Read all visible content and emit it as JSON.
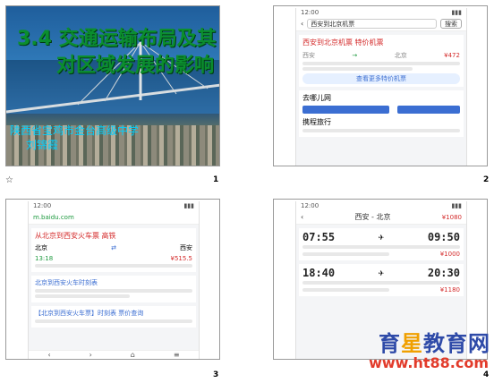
{
  "slide1": {
    "title_line1": "3.4 交通运输布局及其",
    "title_line2": "对区域发展的影响",
    "school": "陕西省宝鸡市金台高级中学",
    "author": "刘锦霞"
  },
  "slide_numbers": [
    "1",
    "2",
    "3",
    "4"
  ],
  "star": "☆",
  "slide2": {
    "time": "12:00",
    "search_query": "西安到北京机票",
    "search_button": "搜索",
    "result_title": "西安到北京机票 特价机票",
    "price_label": "¥472",
    "action_button": "查看更多特价机票",
    "tabs": [
      "西安",
      "北京"
    ],
    "row1": "去哪儿网",
    "row2": "携程旅行"
  },
  "slide3": {
    "time": "12:00",
    "site": "m.baidu.com",
    "title": "从北京到西安火车票 高铁",
    "from": "北京",
    "to": "西安",
    "time_a": "13:18",
    "price_a": "¥515.5",
    "link1": "北京到西安火车时刻表",
    "link2": "【北京到西安火车票】时刻表 票价查询"
  },
  "slide4": {
    "time": "12:00",
    "header": "西安 - 北京",
    "flight1_dep": "07:55",
    "flight1_arr": "09:50",
    "flight1_price": "¥1000",
    "flight2_dep": "18:40",
    "flight2_arr": "20:30",
    "flight2_price": "¥1180",
    "top_price": "¥1080"
  },
  "watermark": {
    "part1": "育",
    "part2": "星",
    "part3": "教育网",
    "url": "www.ht88.com"
  }
}
